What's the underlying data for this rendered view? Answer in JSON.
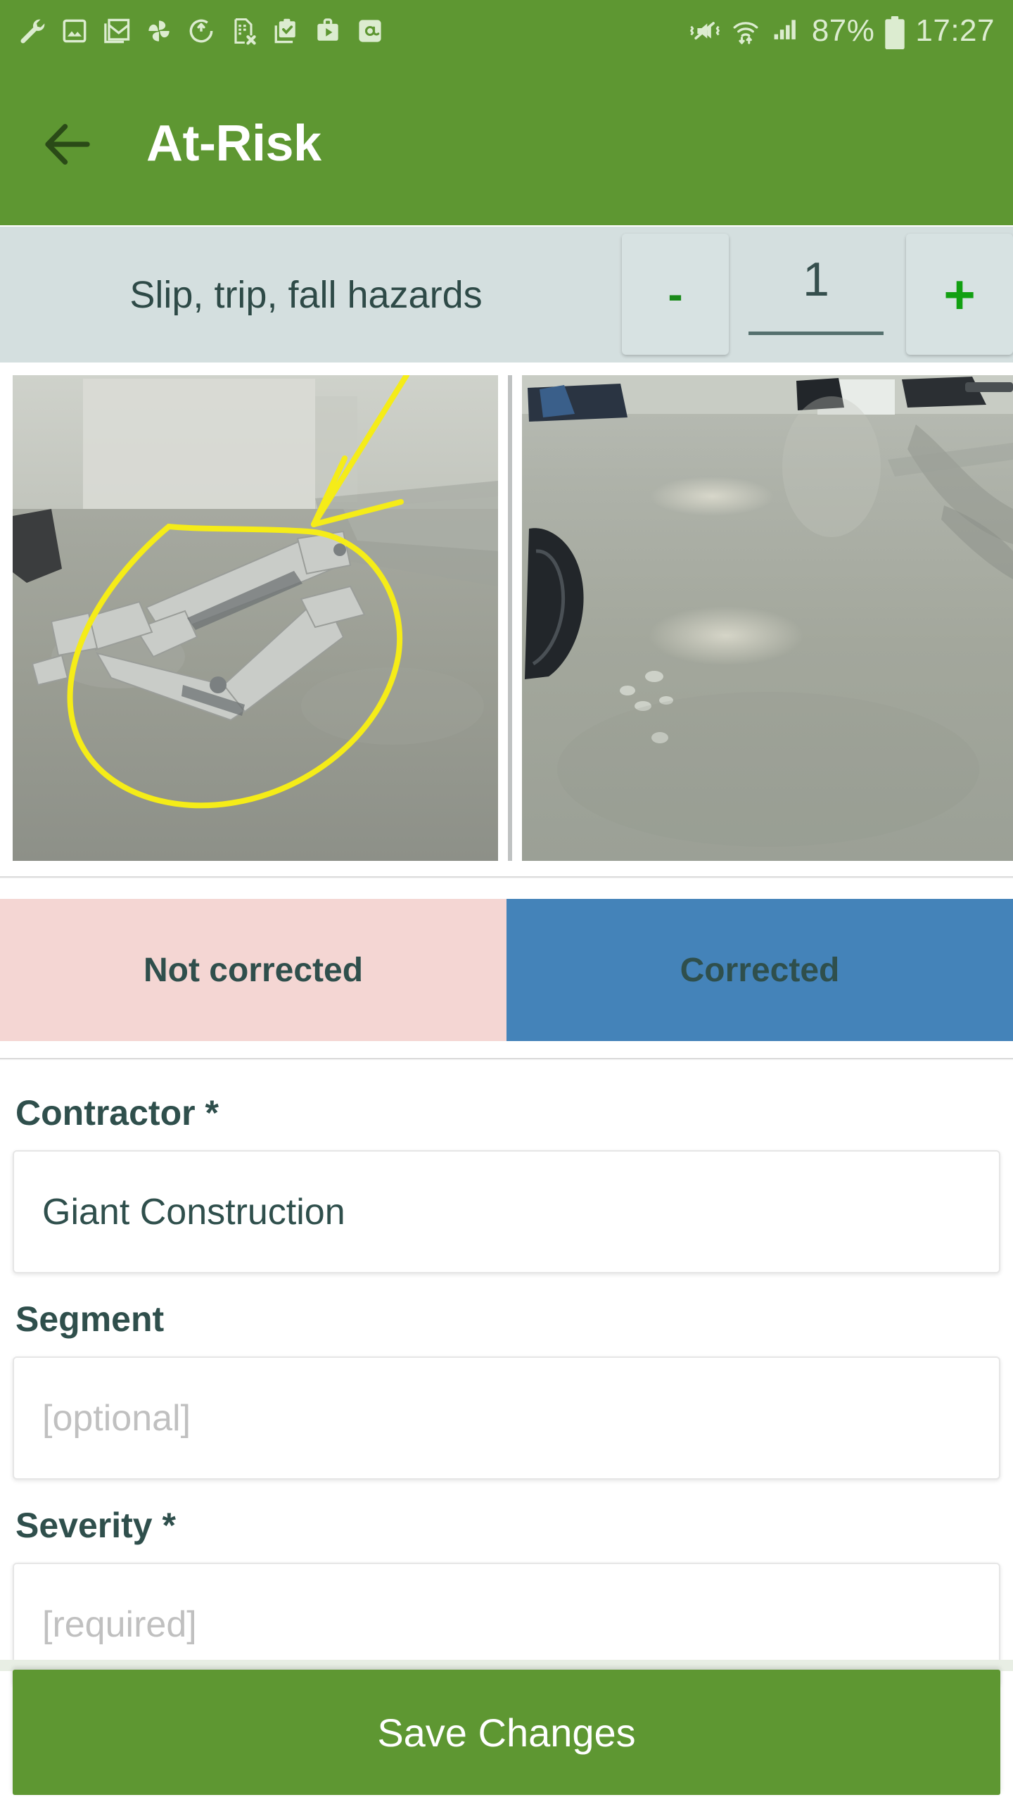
{
  "statusbar": {
    "left_icons": [
      "wrench-icon",
      "photo-icon",
      "gmail-icon",
      "pinwheel-icon",
      "sync-icon",
      "sim-card-error-icon",
      "clipboard-check-icon",
      "work-play-store-icon",
      "email-at-icon"
    ],
    "right_icons": [
      "mute-vibrate-icon",
      "wifi-icon",
      "cell-signal-icon",
      "battery-icon"
    ],
    "battery_percent": "87%",
    "time": "17:27"
  },
  "appbar": {
    "back_label": "back-arrow",
    "title": "At-Risk"
  },
  "counter": {
    "label": "Slip, trip, fall hazards",
    "decrement_label": "-",
    "value": "1",
    "increment_label": "+"
  },
  "photos": {
    "items": [
      {
        "name": "hazard-photo-annotated",
        "alt": "Metal bracket on concrete floor circled in yellow"
      },
      {
        "name": "hazard-photo-corrected",
        "alt": "Clear concrete floor after correction"
      }
    ]
  },
  "status_toggle": {
    "not_corrected_label": "Not corrected",
    "corrected_label": "Corrected",
    "selected": "Corrected"
  },
  "form": {
    "fields": [
      {
        "label": "Contractor *",
        "value": "Giant Construction",
        "placeholder": "",
        "filled": true
      },
      {
        "label": "Segment",
        "value": "",
        "placeholder": "[optional]",
        "filled": false
      },
      {
        "label": "Severity *",
        "value": "",
        "placeholder": "[required]",
        "filled": false
      }
    ]
  },
  "footer": {
    "save_label": "Save Changes"
  },
  "colors": {
    "brand_green": "#5e9732",
    "band_gray": "#d4dfdf",
    "not_corrected_pink": "#f4d6d3",
    "corrected_blue": "#4483b9",
    "label_dark": "#2f4f4c",
    "plus_green": "#12a012"
  }
}
